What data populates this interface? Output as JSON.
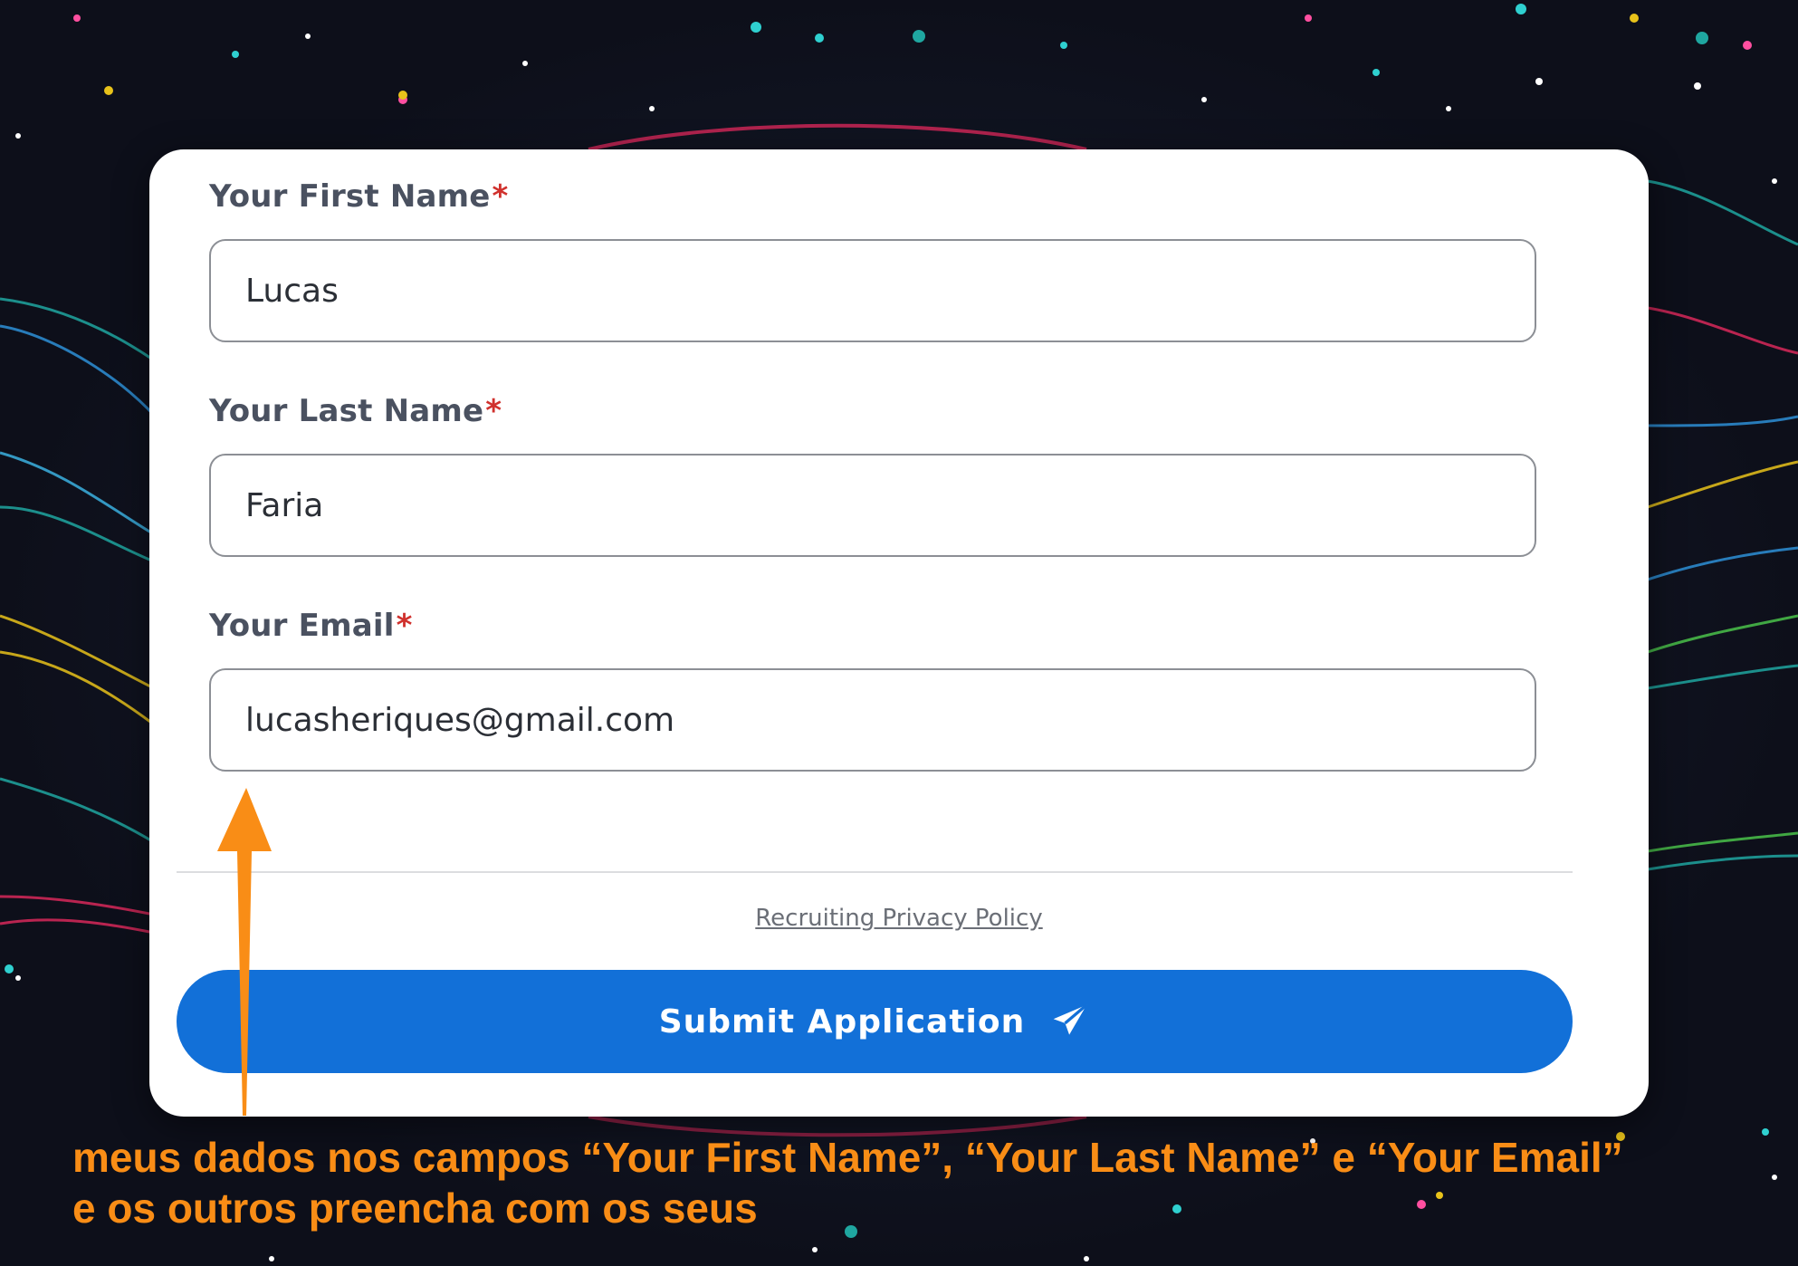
{
  "form": {
    "first_name": {
      "label": "Your First Name",
      "required_mark": "*",
      "value": "Lucas"
    },
    "last_name": {
      "label": "Your Last Name",
      "required_mark": "*",
      "value": "Faria"
    },
    "email": {
      "label": "Your Email",
      "required_mark": "*",
      "value": "lucasheriques@gmail.com"
    },
    "privacy_link": "Recruiting Privacy Policy",
    "submit_label": "Submit Application",
    "submit_icon": "paper-plane-icon"
  },
  "annotation": {
    "line1": "meus dados nos campos “Your First Name”, “Your Last Name” e “Your Email”",
    "line2": "e os outros preencha com os seus",
    "color": "#f98d16",
    "arrow_icon": "up-arrow-icon"
  },
  "colors": {
    "accent": "#1270d8",
    "required": "#d0312d",
    "background": "#0f1220"
  }
}
